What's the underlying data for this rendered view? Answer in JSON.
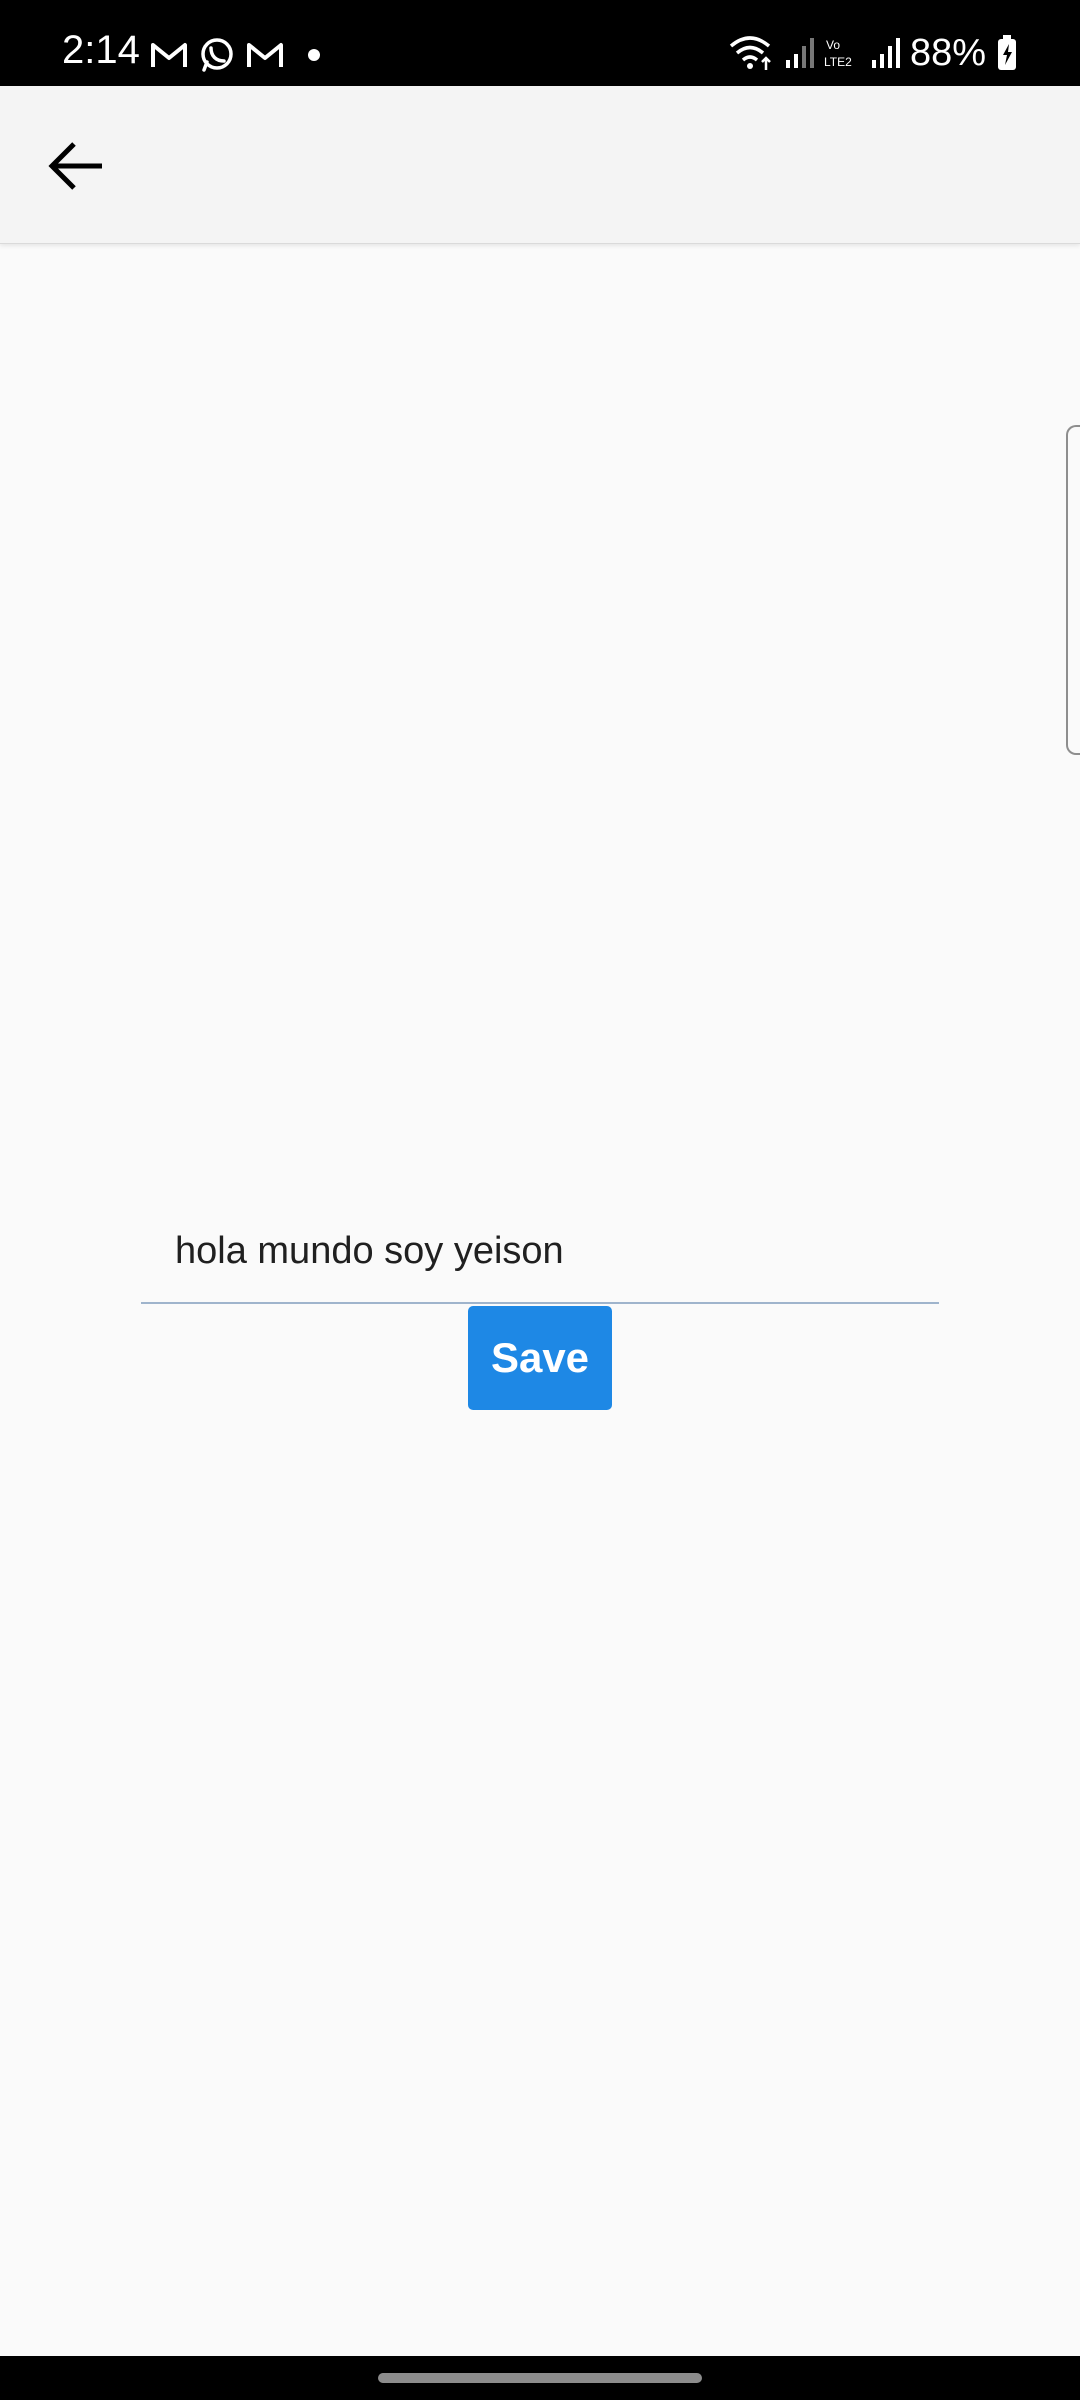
{
  "status_bar": {
    "time": "2:14",
    "battery": "88%",
    "left_icons": [
      "gmail-icon",
      "whatsapp-icon",
      "gmail-icon",
      "dot-icon"
    ],
    "right_icons": [
      "wifi-icon",
      "signal-icon",
      "volte-icon",
      "signal-icon",
      "battery-charging-icon"
    ]
  },
  "app_bar": {
    "back_icon": "arrow-left-icon"
  },
  "form": {
    "input_value": "hola mundo soy yeison",
    "save_label": "Save"
  },
  "colors": {
    "primary": "#1e88e5",
    "background": "#fafafa",
    "app_bar": "#f4f4f4"
  }
}
